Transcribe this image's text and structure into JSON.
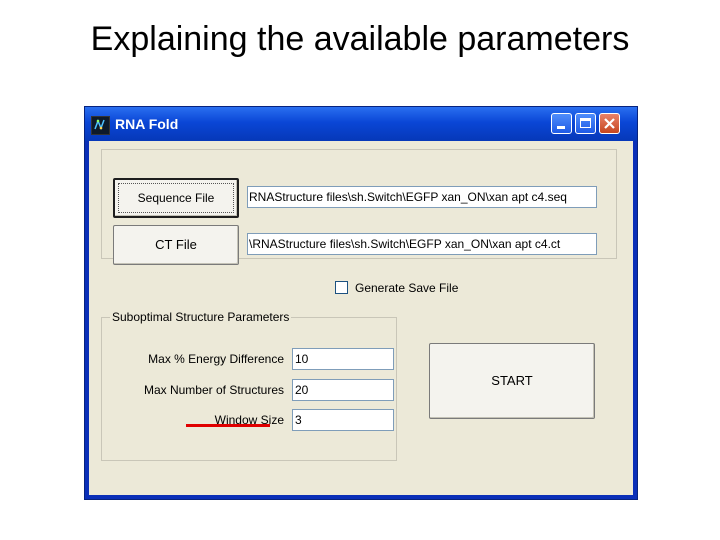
{
  "slide": {
    "title": "Explaining the available parameters"
  },
  "window": {
    "title": "RNA Fold",
    "icon": "rna-fold-app-icon",
    "titlebar_buttons": [
      "minimize-icon",
      "maximize-icon",
      "close-icon"
    ]
  },
  "files": {
    "sequence_button": "Sequence File",
    "sequence_path": "RNAStructure files\\sh.Switch\\EGFP xan_ON\\xan apt c4.seq",
    "ct_button": "CT File",
    "ct_path": "\\RNAStructure files\\sh.Switch\\EGFP xan_ON\\xan apt c4.ct"
  },
  "options": {
    "generate_save_file_label": "Generate Save File",
    "generate_save_file_checked": false
  },
  "suboptimal": {
    "group_title": "Suboptimal Structure Parameters",
    "params": [
      {
        "label": "Max % Energy Difference",
        "value": "10"
      },
      {
        "label": "Max Number of Structures",
        "value": "20"
      },
      {
        "label": "Window Size",
        "value": "3"
      }
    ]
  },
  "start_button": "START",
  "colors": {
    "titlebar": "#0a46d6",
    "client_background": "#ece9d8",
    "highlight_underline": "#e00000"
  }
}
